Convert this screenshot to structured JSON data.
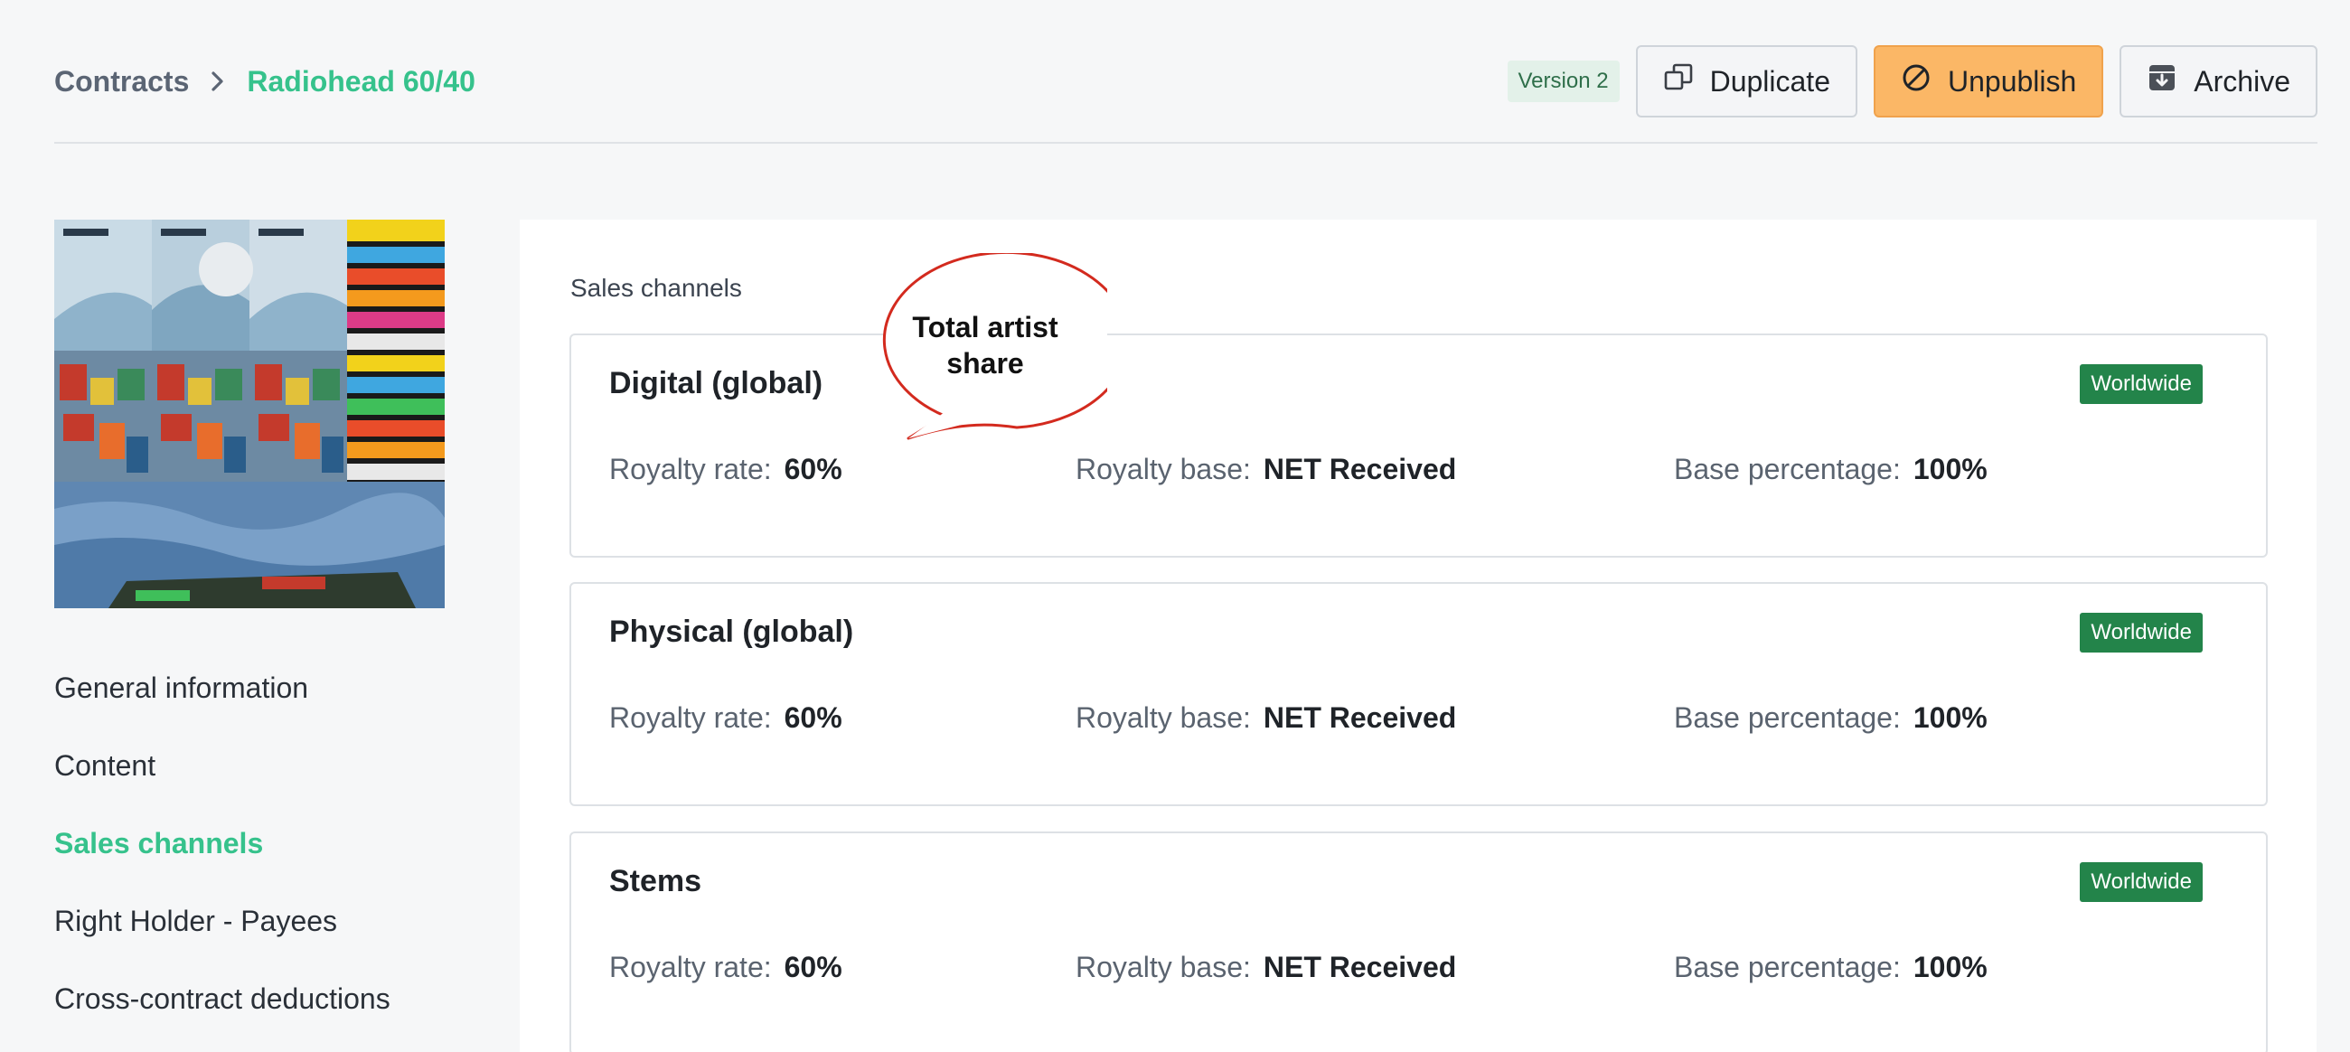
{
  "breadcrumb": {
    "root": "Contracts",
    "separator_icon": "chevron-right-icon",
    "current": "Radiohead 60/40"
  },
  "header": {
    "version_badge": "Version 2",
    "duplicate_label": "Duplicate",
    "unpublish_label": "Unpublish",
    "archive_label": "Archive"
  },
  "sidebar": {
    "cover_alt": "album artwork",
    "items": [
      {
        "label": "General information",
        "active": false
      },
      {
        "label": "Content",
        "active": false
      },
      {
        "label": "Sales channels",
        "active": true
      },
      {
        "label": "Right Holder - Payees",
        "active": false
      },
      {
        "label": "Cross-contract deductions",
        "active": false
      }
    ]
  },
  "main": {
    "section_title": "Sales channels",
    "field_labels": {
      "royalty_rate": "Royalty rate:",
      "royalty_base": "Royalty base:",
      "base_percentage": "Base percentage:"
    },
    "channels": [
      {
        "title": "Digital (global)",
        "region": "Worldwide",
        "royalty_rate": "60%",
        "royalty_base": "NET Received",
        "base_percentage": "100%"
      },
      {
        "title": "Physical (global)",
        "region": "Worldwide",
        "royalty_rate": "60%",
        "royalty_base": "NET Received",
        "base_percentage": "100%"
      },
      {
        "title": "Stems",
        "region": "Worldwide",
        "royalty_rate": "60%",
        "royalty_base": "NET Received",
        "base_percentage": "100%"
      }
    ]
  },
  "annotation": {
    "callout_text": "Total artist share"
  },
  "colors": {
    "accent_green": "#36c28c",
    "badge_green": "#23844a",
    "warn_orange": "#fbb766",
    "callout_red": "#d32a1e"
  }
}
